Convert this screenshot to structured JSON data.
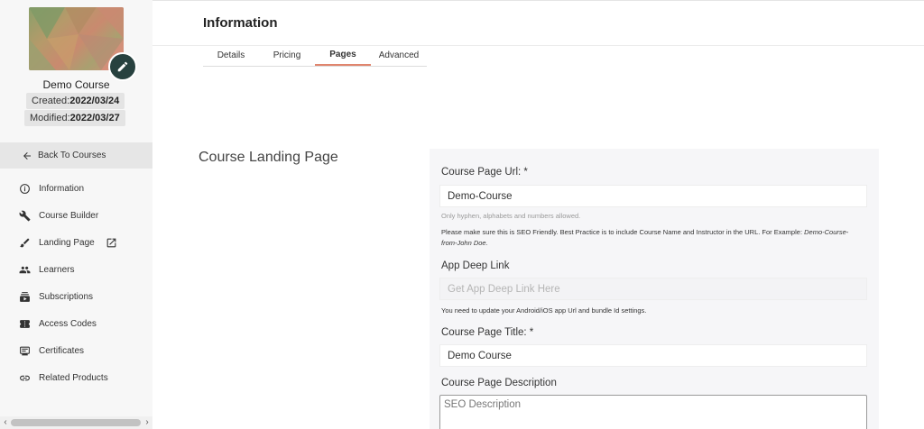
{
  "sidebar": {
    "course_name": "Demo Course",
    "created_label": "Created:",
    "created_value": "2022/03/24",
    "modified_label": "Modified:",
    "modified_value": "2022/03/27",
    "back_label": "Back To Courses",
    "items": [
      {
        "label": "Information",
        "icon": "info-icon"
      },
      {
        "label": "Course Builder",
        "icon": "wrench-icon"
      },
      {
        "label": "Landing Page",
        "icon": "brush-icon",
        "extra_icon": "open-external-icon"
      },
      {
        "label": "Learners",
        "icon": "people-icon"
      },
      {
        "label": "Subscriptions",
        "icon": "subscriptions-icon"
      },
      {
        "label": "Access Codes",
        "icon": "ticket-icon"
      },
      {
        "label": "Certificates",
        "icon": "certificate-icon"
      },
      {
        "label": "Related Products",
        "icon": "link-icon"
      }
    ]
  },
  "header": {
    "title": "Information",
    "tabs": [
      {
        "label": "Details",
        "active": false
      },
      {
        "label": "Pricing",
        "active": false
      },
      {
        "label": "Pages",
        "active": true
      },
      {
        "label": "Advanced",
        "active": false
      }
    ]
  },
  "main": {
    "section_title": "Course Landing Page",
    "url_label": "Course Page Url: *",
    "url_value": "Demo-Course",
    "url_hint": "Only hyphen, alphabets and numbers allowed.",
    "url_note": "Please make sure this is SEO Friendly. Best Practice is to include Course Name and Instructor in the URL. For Example: ",
    "url_note_example": "Demo-Course-from-John Doe.",
    "deeplink_label": "App Deep Link",
    "deeplink_placeholder": "Get App Deep Link Here",
    "deeplink_note": "You need to update your Android/iOS app Url and bundle Id settings.",
    "title_label": "Course Page Title: *",
    "title_value": "Demo Course",
    "description_label": "Course Page Description",
    "description_placeholder": "SEO Description"
  },
  "colors": {
    "accent_tab_underline": "#e0856e",
    "edit_button": "#27413f"
  }
}
